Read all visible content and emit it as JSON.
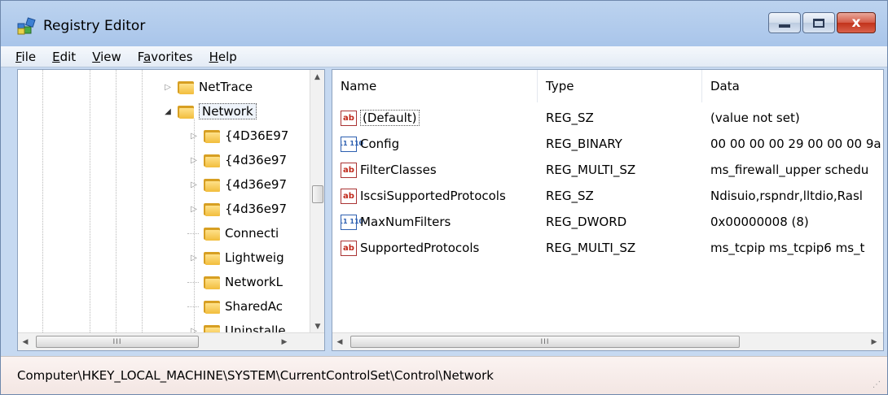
{
  "window": {
    "title": "Registry Editor",
    "minimize": "minimize",
    "maximize": "maximize",
    "close": "close"
  },
  "menu": [
    {
      "mnemonic": "F",
      "rest": "ile"
    },
    {
      "mnemonic": "E",
      "rest": "dit"
    },
    {
      "mnemonic": "V",
      "rest": "iew"
    },
    {
      "pre": "F",
      "mnemonic": "a",
      "rest": "vorites"
    },
    {
      "mnemonic": "H",
      "rest": "elp"
    }
  ],
  "tree": {
    "items": [
      {
        "label": "NetTrace",
        "expander": "▷",
        "level": 0
      },
      {
        "label": "Network",
        "expander": "◢",
        "level": 0,
        "selected": true
      },
      {
        "label": "{4D36E97",
        "expander": "▷",
        "level": 1
      },
      {
        "label": "{4d36e97",
        "expander": "▷",
        "level": 1
      },
      {
        "label": "{4d36e97",
        "expander": "▷",
        "level": 1
      },
      {
        "label": "{4d36e97",
        "expander": "▷",
        "level": 1
      },
      {
        "label": "Connecti",
        "expander": "",
        "level": 1
      },
      {
        "label": "Lightweig",
        "expander": "▷",
        "level": 1
      },
      {
        "label": "NetworkL",
        "expander": "",
        "level": 1
      },
      {
        "label": "SharedAc",
        "expander": "",
        "level": 1
      },
      {
        "label": "Uninstalle",
        "expander": "▷",
        "level": 1
      }
    ],
    "hscroll_thumb": "III"
  },
  "list": {
    "columns": [
      "Name",
      "Type",
      "Data"
    ],
    "rows": [
      {
        "icon": "string-value-icon",
        "icon_text": "ab",
        "name": "(Default)",
        "type": "REG_SZ",
        "data": "(value not set)"
      },
      {
        "icon": "binary-value-icon",
        "icon_text": "011 110",
        "name": "Config",
        "type": "REG_BINARY",
        "data": "00 00 00 00 29 00 00 00 9a"
      },
      {
        "icon": "string-value-icon",
        "icon_text": "ab",
        "name": "FilterClasses",
        "type": "REG_MULTI_SZ",
        "data": "ms_firewall_upper schedu"
      },
      {
        "icon": "string-value-icon",
        "icon_text": "ab",
        "name": "IscsiSupportedProtocols",
        "type": "REG_SZ",
        "data": "Ndisuio,rspndr,lltdio,Rasl"
      },
      {
        "icon": "binary-value-icon",
        "icon_text": "011 110",
        "name": "MaxNumFilters",
        "type": "REG_DWORD",
        "data": "0x00000008 (8)"
      },
      {
        "icon": "string-value-icon",
        "icon_text": "ab",
        "name": "SupportedProtocols",
        "type": "REG_MULTI_SZ",
        "data": "ms_tcpip ms_tcpip6 ms_t"
      }
    ],
    "hscroll_thumb": "III"
  },
  "status": {
    "path": "Computer\\HKEY_LOCAL_MACHINE\\SYSTEM\\CurrentControlSet\\Control\\Network"
  },
  "glyphs": {
    "left": "◀",
    "right": "▶",
    "up": "▲",
    "down": "▼",
    "x": "x"
  },
  "colors": {
    "chrome": "#a9c5ea",
    "close": "#c2321b",
    "folder": "#f2bd3c",
    "status_bg": "#f3e6e3"
  }
}
